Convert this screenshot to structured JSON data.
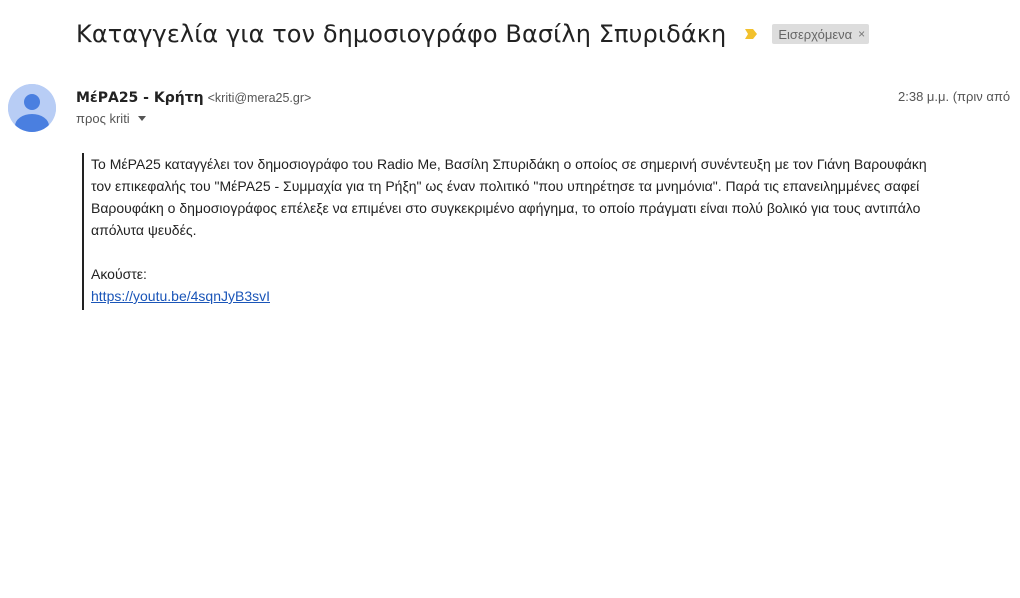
{
  "email": {
    "subject": "Καταγγελία για τον δημοσιογράφο Βασίλη Σπυριδάκη",
    "label": "Εισερχόμενα",
    "label_remove": "×",
    "sender_name": "ΜέΡΑ25 - Κρήτη",
    "sender_email": "<kriti@mera25.gr>",
    "time": "2:38 μ.μ. (πριν από",
    "to": "προς kriti",
    "body": {
      "lines": [
        "Το ΜέΡΑ25 καταγγέλει τον δημοσιογράφο του Radio Me, Βασίλη Σπυριδάκη ο οποίος σε σημερινή συνέντευξη με τον Γιάνη Βαρουφάκη",
        "τον επικεφαλής του \"ΜέΡΑ25 - Συμμαχία για τη Ρήξη\" ως έναν πολιτικό \"που υπηρέτησε τα μνημόνια\". Παρά τις επανειλημμένες σαφεί",
        "Βαρουφάκη ο δημοσιογράφος επέλεξε να επιμένει στο συγκεκριμένο αφήγημα, το οποίο πράγματι είναι πολύ βολικό για τους αντιπάλο",
        "απόλυτα ψευδές."
      ],
      "listen_label": "Ακούστε:",
      "link_text": "https://youtu.be/4sqnJyB3svI"
    }
  },
  "icons": {
    "importance": "importance-marker-icon",
    "avatar": "default-avatar-icon",
    "caret": "chevron-down-icon"
  },
  "colors": {
    "importance": "#f2c12e",
    "link": "#1a55b8",
    "avatar_bg": "#b8cdf5",
    "avatar_fg": "#4a7fe0"
  }
}
